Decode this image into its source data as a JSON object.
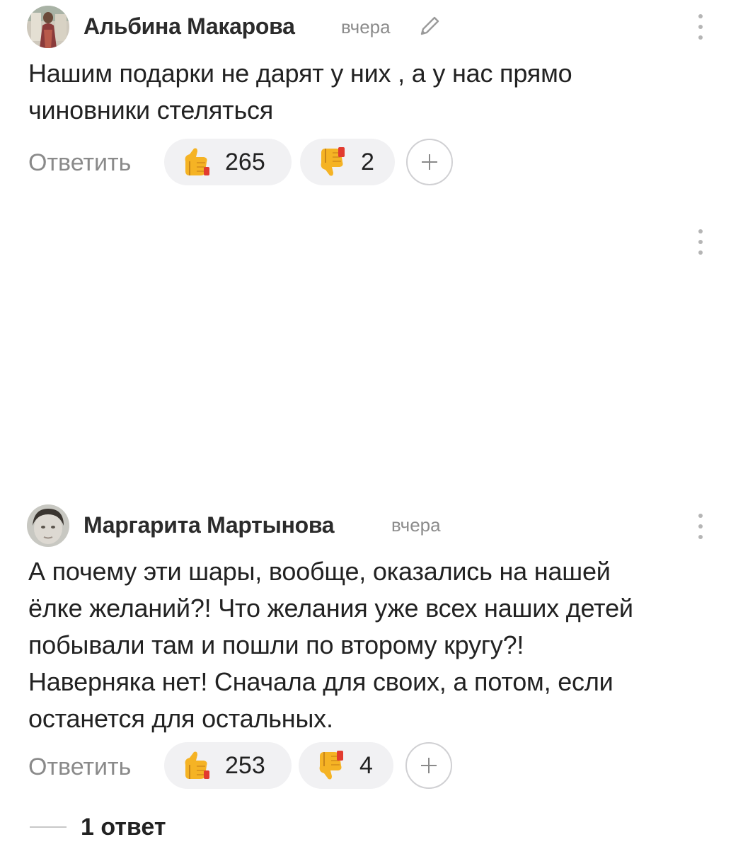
{
  "comments": [
    {
      "author": "Альбина Макарова",
      "time": "вчера",
      "edited": true,
      "text_lines": [
        "Нашим подарки не дарят у них , а у нас прямо",
        "чиновники стеляться"
      ],
      "reply_label": "Ответить",
      "likes": "265",
      "dislikes": "2"
    },
    {
      "author": "Маргарита Мартынова",
      "time": "вчера",
      "text_lines": [
        "А почему эти шары, вообще, оказались на нашей",
        "ёлке желаний?! Что желания уже всех наших детей",
        "побывали там и пошли по второму кругу?!",
        "Наверняка нет! Сначала для своих, а потом, если",
        "останется для остальных."
      ],
      "reply_label": "Ответить",
      "likes": "253",
      "dislikes": "4",
      "replies_label": "1 ответ"
    }
  ],
  "icons": {
    "like": "thumbs-up-icon",
    "dislike": "thumbs-down-icon",
    "add": "plus-icon",
    "more": "more-vertical-icon",
    "edit": "pencil-icon"
  }
}
